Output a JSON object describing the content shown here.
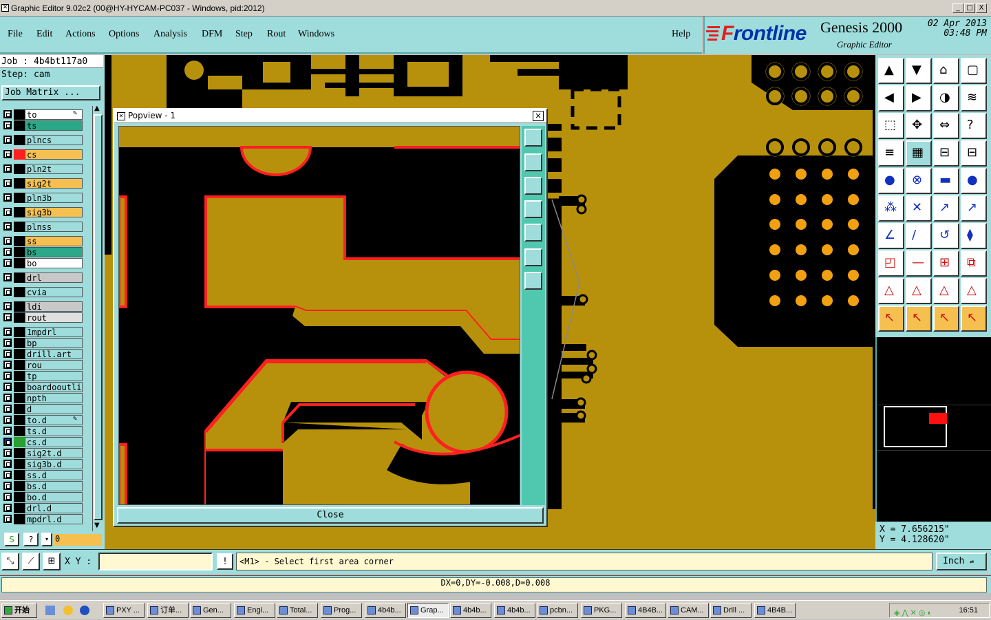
{
  "window": {
    "title": "Graphic Editor 9.02c2 (00@HY-HYCAM-PC037 - Windows, pid:2012)",
    "minimize": "_",
    "maximize": "□",
    "close": "X"
  },
  "menu": [
    "File",
    "Edit",
    "Actions",
    "Options",
    "Analysis",
    "DFM",
    "Step",
    "Rout",
    "Windows"
  ],
  "help": "Help",
  "brand": {
    "logo_prefix": "F",
    "logo_rest": "rontline",
    "product": "Genesis 2000",
    "subtitle": "Graphic Editor",
    "date": "02 Apr 2013",
    "time": "03:48 PM"
  },
  "job": {
    "job_line": "Job : 4b4bt117a0",
    "step_line": "Step: cam",
    "matrix_button": "Job Matrix ..."
  },
  "layers": [
    {
      "name": "to",
      "color": "#ffffff",
      "swatch": "#000000",
      "edit": true
    },
    {
      "name": "ts",
      "color": "#2aa888",
      "swatch": "#000000"
    },
    {
      "name": "plncs",
      "color": "#9fdcdc",
      "swatch": "#000000"
    },
    {
      "name": "cs",
      "color": "#f5c050",
      "swatch": "#ff2020"
    },
    {
      "name": "pln2t",
      "color": "#9fdcdc",
      "swatch": "#000000"
    },
    {
      "name": "sig2t",
      "color": "#f5c050",
      "swatch": "#000000"
    },
    {
      "name": "pln3b",
      "color": "#9fdcdc",
      "swatch": "#000000"
    },
    {
      "name": "sig3b",
      "color": "#f5c050",
      "swatch": "#000000"
    },
    {
      "name": "plnss",
      "color": "#9fdcdc",
      "swatch": "#000000"
    },
    {
      "name": "ss",
      "color": "#f5c050",
      "swatch": "#000000"
    },
    {
      "name": "bs",
      "color": "#2aa888",
      "swatch": "#000000"
    },
    {
      "name": "bo",
      "color": "#ffffff",
      "swatch": "#000000"
    },
    {
      "name": "drl",
      "color": "#c8c8c8",
      "swatch": "#000000"
    },
    {
      "name": "cvia",
      "color": "#9fdcdc",
      "swatch": "#000000"
    },
    {
      "name": "ldi",
      "color": "#c8c8c8",
      "swatch": "#000000"
    },
    {
      "name": "rout",
      "color": "#e0e0e0",
      "swatch": "#000000"
    },
    {
      "name": "1mpdrl",
      "color": "#9fdcdc",
      "swatch": "#000000"
    },
    {
      "name": "bp",
      "color": "#9fdcdc",
      "swatch": "#000000"
    },
    {
      "name": "drill.art",
      "color": "#9fdcdc",
      "swatch": "#000000"
    },
    {
      "name": "rou",
      "color": "#9fdcdc",
      "swatch": "#000000"
    },
    {
      "name": "tp",
      "color": "#9fdcdc",
      "swatch": "#000000"
    },
    {
      "name": "boardooutli",
      "color": "#9fdcdc",
      "swatch": "#000000"
    },
    {
      "name": "npth",
      "color": "#9fdcdc",
      "swatch": "#000000"
    },
    {
      "name": "d",
      "color": "#9fdcdc",
      "swatch": "#000000"
    },
    {
      "name": "to.d",
      "color": "#9fdcdc",
      "swatch": "#000000",
      "edit": true
    },
    {
      "name": "ts.d",
      "color": "#9fdcdc",
      "swatch": "#000000"
    },
    {
      "name": "cs.d",
      "color": "#9fdcdc",
      "swatch": "#2aa030",
      "active": true
    },
    {
      "name": "sig2t.d",
      "color": "#9fdcdc",
      "swatch": "#000000"
    },
    {
      "name": "sig3b.d",
      "color": "#9fdcdc",
      "swatch": "#000000"
    },
    {
      "name": "ss.d",
      "color": "#9fdcdc",
      "swatch": "#000000"
    },
    {
      "name": "bs.d",
      "color": "#9fdcdc",
      "swatch": "#000000"
    },
    {
      "name": "bo.d",
      "color": "#9fdcdc",
      "swatch": "#000000"
    },
    {
      "name": "drl.d",
      "color": "#9fdcdc",
      "swatch": "#000000"
    },
    {
      "name": "mpdrl.d",
      "color": "#9fdcdc",
      "swatch": "#000000"
    }
  ],
  "left_bottom": {
    "value": "0"
  },
  "popview": {
    "title": "Popview - 1",
    "close_label": "Close"
  },
  "coords": {
    "x": "X = 7.656215\"",
    "y": "Y = 4.128620\""
  },
  "cmd": {
    "xy_label": "X Y :",
    "message": "<M1> - Select first area corner",
    "units": "Inch"
  },
  "status": "DX=0,DY=-0.008,D=0.008",
  "taskbar": {
    "start": "开始",
    "items": [
      "PXY ...",
      "订单...",
      "Gen...",
      "Engi...",
      "Total...",
      "Prog...",
      "4b4b...",
      "Grap...",
      "4b4b...",
      "4b4b...",
      "pcbn...",
      "PKG...",
      "4B4B...",
      "CAM...",
      "Drill ...",
      "4B4B..."
    ],
    "active_index": 7,
    "clock": "16:51"
  },
  "colors": {
    "board": "#b8910c",
    "copper_outline": "#ff2020",
    "panel": "#9fdcdc",
    "accent_teal": "#50c8b0"
  }
}
